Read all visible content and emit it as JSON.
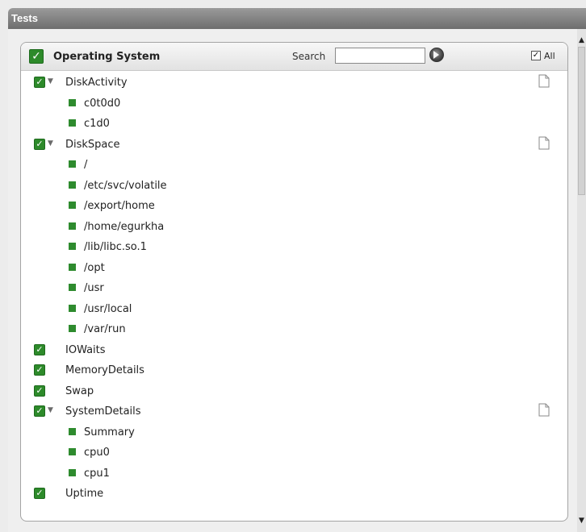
{
  "window": {
    "title": "Tests"
  },
  "panel": {
    "title": "Operating System",
    "search_label": "Search",
    "search_value": "",
    "all_label": "All",
    "all_checked": true
  },
  "tests": [
    {
      "name": "DiskActivity",
      "expanded": true,
      "items": [
        "c0t0d0",
        "c1d0"
      ]
    },
    {
      "name": "DiskSpace",
      "expanded": true,
      "items": [
        "/",
        "/etc/svc/volatile",
        "/export/home",
        "/home/egurkha",
        "/lib/libc.so.1",
        "/opt",
        "/usr",
        "/usr/local",
        "/var/run"
      ]
    },
    {
      "name": "IOWaits",
      "items": []
    },
    {
      "name": "MemoryDetails",
      "items": []
    },
    {
      "name": "Swap",
      "items": []
    },
    {
      "name": "SystemDetails",
      "expanded": true,
      "items": [
        "Summary",
        "cpu0",
        "cpu1"
      ]
    },
    {
      "name": "Uptime",
      "items": []
    }
  ],
  "icons": {
    "checkbox": "green-check",
    "expander": "triangle-down",
    "details": "document-icon",
    "go": "search-go-icon"
  },
  "colors": {
    "check_green": "#2d8a2a",
    "title_bar": "#7a7a7a"
  }
}
